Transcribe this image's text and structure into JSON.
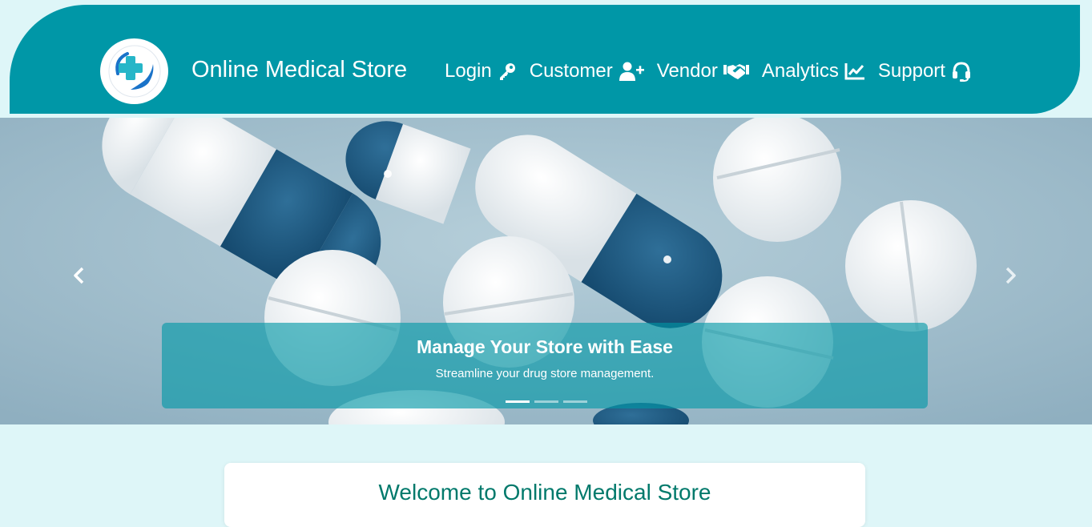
{
  "header": {
    "brand": "Online Medical Store",
    "logo_icon": "medical-cross-hand-icon",
    "colors": {
      "bar": "#0097a7",
      "text": "#ffffff"
    },
    "nav": [
      {
        "label": "Login",
        "icon": "key-icon"
      },
      {
        "label": "Customer",
        "icon": "user-plus-icon"
      },
      {
        "label": "Vendor",
        "icon": "handshake-icon"
      },
      {
        "label": "Analytics",
        "icon": "chart-line-icon"
      },
      {
        "label": "Support",
        "icon": "headset-icon"
      }
    ]
  },
  "carousel": {
    "caption_title": "Manage Your Store with Ease",
    "caption_text": "Streamline your drug store management.",
    "slide_count": 3,
    "active_index": 0
  },
  "welcome": {
    "title": "Welcome to Online Medical Store",
    "title_color": "#00796b"
  }
}
